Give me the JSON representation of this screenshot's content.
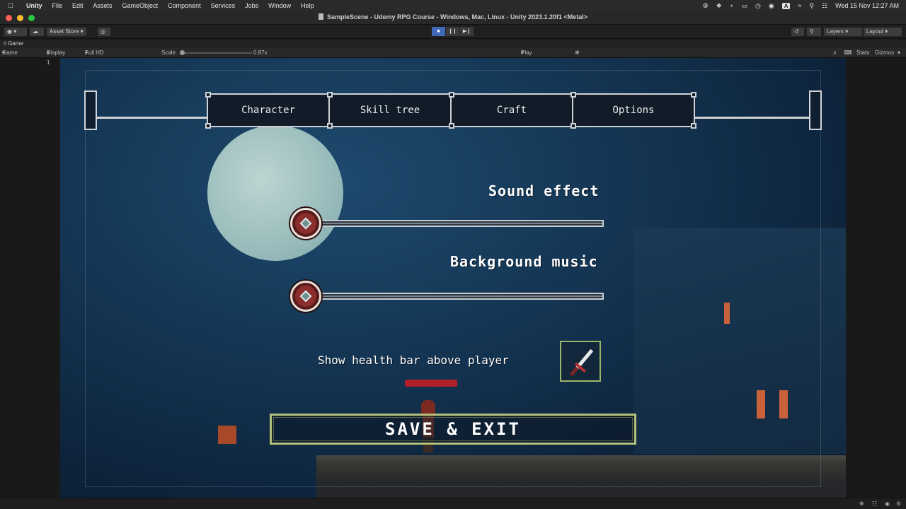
{
  "menubar": {
    "app": "Unity",
    "items": [
      "File",
      "Edit",
      "Assets",
      "GameObject",
      "Component",
      "Services",
      "Jobs",
      "Window",
      "Help"
    ],
    "clock": "Wed 15 Nov  12:27 AM",
    "input_source": "A"
  },
  "window": {
    "title": "SampleScene - Udemy RPG Course - Windows, Mac, Linux - Unity 2023.1.20f1 <Metal>"
  },
  "toolbar": {
    "asset_store": "Asset Store",
    "layers": "Layers",
    "layout": "Layout"
  },
  "game_view": {
    "tab_label": "Game",
    "mode": "Game",
    "display": "Display 1",
    "resolution": "Full HD (1920x1080)",
    "scale_label": "Scale",
    "scale_value": "0.87x",
    "play_mode": "Play Maximized",
    "stats": "Stats",
    "gizmos": "Gizmos"
  },
  "ui": {
    "tabs": [
      {
        "label": "Character"
      },
      {
        "label": "Skill tree"
      },
      {
        "label": "Craft"
      },
      {
        "label": "Options"
      }
    ],
    "sound_effect_label": "Sound effect",
    "background_music_label": "Background music",
    "sound_effect_value": 0.0,
    "background_music_value": 0.0,
    "health_bar_label": "Show health bar above player",
    "save_exit_label": "SAVE & EXIT"
  },
  "colors": {
    "accent": "#3f6ab8",
    "health": "#b0202a",
    "button_border": "#b4c07a",
    "knob": "#8a2d2d"
  }
}
